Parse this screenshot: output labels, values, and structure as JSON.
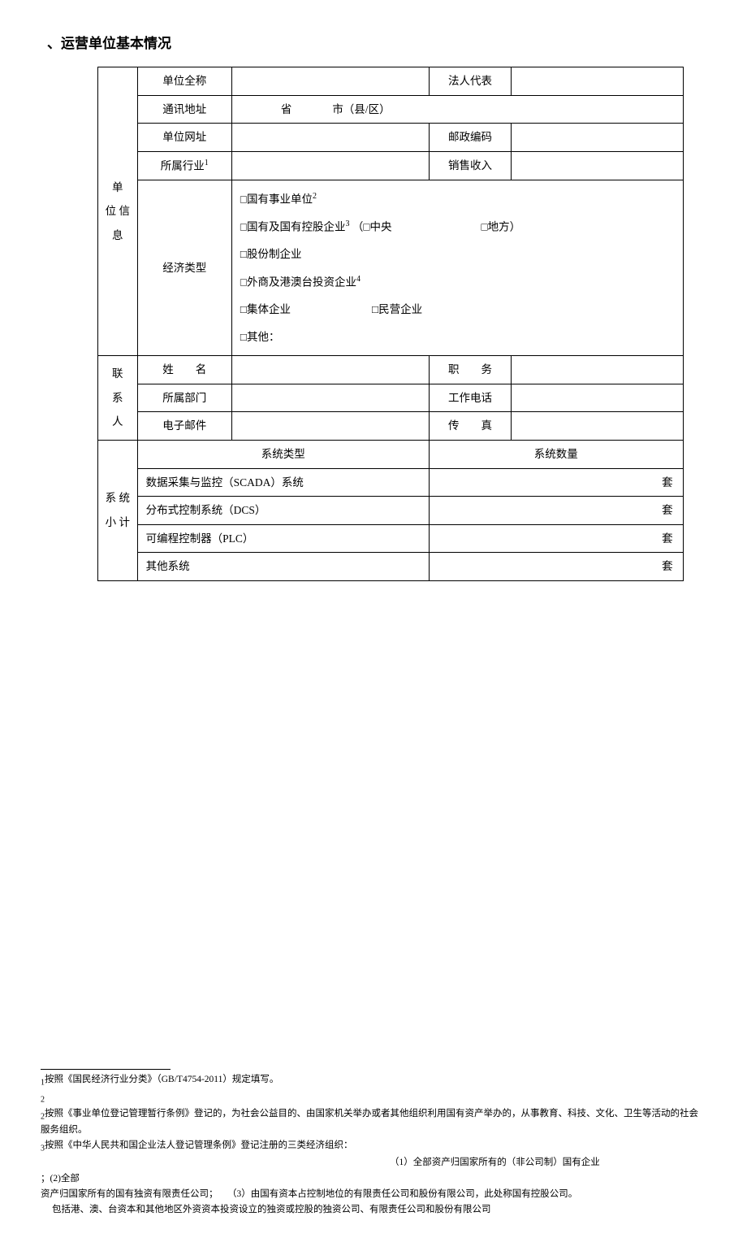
{
  "heading": "、运营单位基本情况",
  "rowheads": {
    "unit": "单\n位 信\n息",
    "contact": "联\n系\n人",
    "sys": "系 统\n小 计"
  },
  "labels": {
    "fullname": "单位全称",
    "legalrep": "法人代表",
    "address": "通讯地址",
    "addr_val_prefix_prov": "省",
    "addr_val_prefix_city": "市（县/区）",
    "url": "单位网址",
    "postcode": "邮政编码",
    "industry": "所属行业",
    "industry_sup": "1",
    "sales": "销售收入",
    "econtype": "经济类型",
    "name": "姓　　名",
    "position": "职　　务",
    "dept": "所属部门",
    "workphone": "工作电话",
    "email": "电子邮件",
    "fax": "传　　真",
    "systype": "系统类型",
    "syscount": "系统数量"
  },
  "econ": {
    "l1": "□国有事业单位",
    "l1_sup": "2",
    "l2a": "□国有及国有控股企业",
    "l2a_sup": "3",
    "l2b": "（□中央",
    "l2c": "□地方）",
    "l3": "□股份制企业",
    "l4": "□外商及港澳台投资企业",
    "l4_sup": "4",
    "l5a": "□集体企业",
    "l5b": "□民营企业",
    "l6": "□其他："
  },
  "sys": {
    "r1": "数据采集与监控（SCADA）系统",
    "r2": "分布式控制系统（DCS）",
    "r3": "可编程控制器（PLC）",
    "r4": "其他系统",
    "unit": "套"
  },
  "footnotes": {
    "f1": "按照《国民经济行业分类》（GB/T4754-2011）规定填写。",
    "f2_empty": "",
    "f2": "按照《事业单位登记管理暂行条例》登记的，为社会公益目的、由国家机关举办或者其他组织利用国有资产举办的，从事教育、科技、文化、卫生等活动的社会服务组织。",
    "f3_a": "按照《中华人民共和国企业法人登记管理条例》登记注册的三类经济组织：",
    "f3_b": "（1）全部资产归国家所有的（非公司制）国有企业",
    "f3_c": "；(2)全部",
    "f3_d": "资产归国家所有的国有独资有限责任公司；　　（3）由国有资本占控制地位的有限责任公司和股份有限公司，此处称国有控股公司。",
    "f4": "包括港、澳、台资本和其他地区外资资本投资设立的独资或控股的独资公司、有限责任公司和股份有限公司"
  }
}
